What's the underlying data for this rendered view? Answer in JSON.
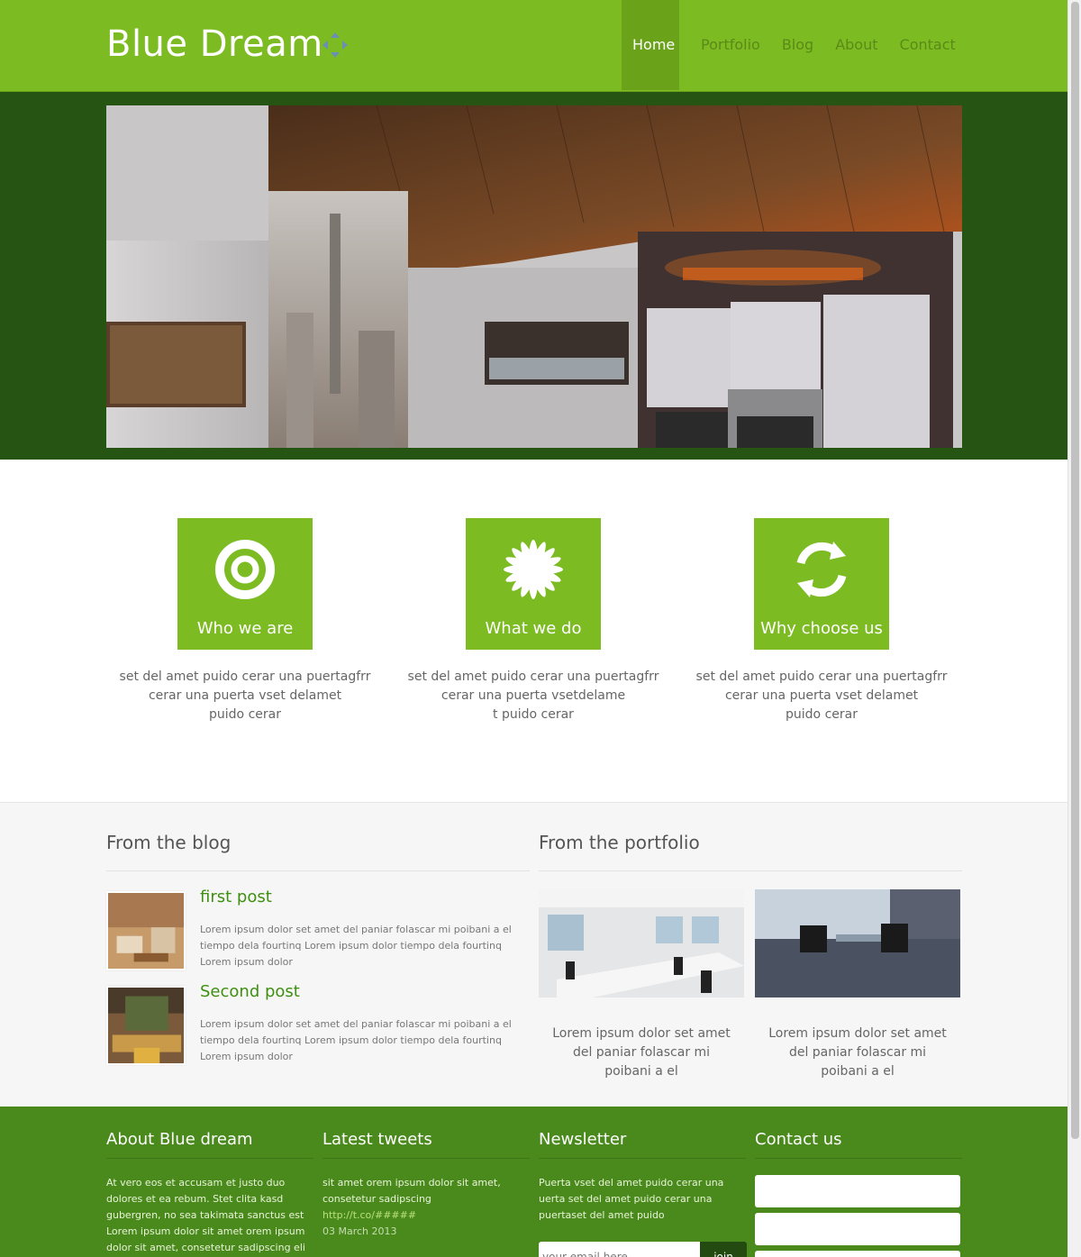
{
  "header": {
    "brand": "Blue Dream",
    "nav": [
      "Home",
      "Portfolio",
      "Blog",
      "About",
      "Contact"
    ],
    "active": "Home"
  },
  "features": [
    {
      "title": "Who we are",
      "icon": "ring-icon",
      "lines": [
        "set del amet puido cerar una puertagfrr",
        "cerar una puerta vset delamet",
        "puido cerar"
      ]
    },
    {
      "title": "What we do",
      "icon": "flower-icon",
      "lines": [
        "set del amet puido cerar una puertagfrr",
        "cerar una puerta vsetdelame",
        "t puido cerar"
      ]
    },
    {
      "title": "Why choose us",
      "icon": "refresh-icon",
      "lines": [
        "set del amet puido cerar una puertagfrr",
        "cerar una puerta vset delamet",
        "puido cerar"
      ]
    }
  ],
  "blog": {
    "title": "From the blog",
    "posts": [
      {
        "title": "first post",
        "text": "Lorem ipsum dolor set amet del paniar folascar mi poibani a el tiempo dela fourtinq Lorem ipsum dolor tiempo dela fourtinq Lorem ipsum dolor"
      },
      {
        "title": "Second post",
        "text": "Lorem ipsum dolor set amet del paniar folascar mi poibani a el tiempo dela fourtinq Lorem ipsum dolor tiempo dela fourtinq Lorem ipsum dolor"
      }
    ]
  },
  "portfolio": {
    "title": "From the portfolio",
    "items": [
      {
        "text": "Lorem ipsum dolor set amet del paniar folascar mi poibani a el"
      },
      {
        "text": "Lorem ipsum dolor set amet del paniar folascar mi poibani a el"
      }
    ]
  },
  "footer": {
    "about": {
      "title": "About Blue dream",
      "text": "At vero eos et accusam et justo duo dolores et ea rebum. Stet clita kasd gubergren, no sea takimata sanctus est Lorem ipsum dolor sit amet orem ipsum dolor sit amet, consetetur sadipscing eli"
    },
    "tweets": {
      "title": "Latest tweets",
      "text": "sit amet orem ipsum dolor sit amet, consetetur sadipscing",
      "link": "http://t.co/#####",
      "date": "03 March 2013"
    },
    "newsletter": {
      "title": "Newsletter",
      "text": "Puerta vset del amet puido cerar una uerta set del amet puido cerar una puertaset del amet puido",
      "placeholder": "your email here",
      "button": "join"
    },
    "contact": {
      "title": "Contact us"
    }
  },
  "colors": {
    "brand_green": "#7cbb22",
    "dark_green": "#265513",
    "footer_green": "#4a8a1c",
    "post_title": "#3f8f10"
  }
}
